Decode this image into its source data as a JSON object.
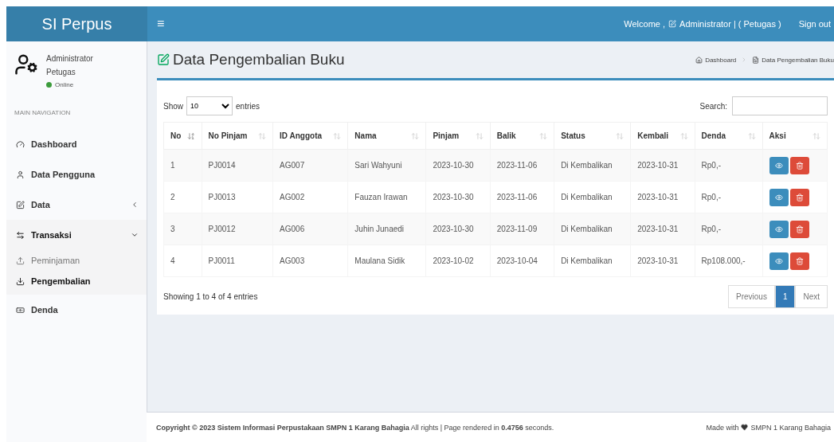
{
  "header": {
    "logo": "SI Perpus",
    "menu_toggle": "≡",
    "welcome": "Welcome ,",
    "user": "Administrator | ( Petugas )",
    "sign_out": "Sign out"
  },
  "user_panel": {
    "name": "Administrator",
    "role": "Petugas",
    "status": "Online"
  },
  "sidebar": {
    "heading": "MAIN NAVIGATION",
    "items": [
      {
        "label": "Dashboard",
        "selected": false
      },
      {
        "label": "Data Pengguna",
        "selected": false
      },
      {
        "label": "Data",
        "selected": false,
        "expanded": false
      },
      {
        "label": "Transaksi",
        "selected": true,
        "expanded": true,
        "children": [
          {
            "label": "Peminjaman",
            "selected": false
          },
          {
            "label": "Pengembalian",
            "selected": true
          }
        ]
      },
      {
        "label": "Denda",
        "selected": false
      }
    ]
  },
  "page": {
    "title": "Data Pengembalian Buku",
    "breadcrumb": [
      "Dashboard",
      "Data Pengembalian Buku"
    ]
  },
  "table_controls": {
    "show": "Show",
    "page_size": "10",
    "entries": "entries",
    "search_label": "Search:"
  },
  "table": {
    "columns": [
      {
        "label": "No",
        "sorted": true
      },
      {
        "label": "No Pinjam",
        "sorted": false
      },
      {
        "label": "ID Anggota",
        "sorted": false
      },
      {
        "label": "Nama",
        "sorted": false
      },
      {
        "label": "Pinjam",
        "sorted": false
      },
      {
        "label": "Balik",
        "sorted": false
      },
      {
        "label": "Status",
        "sorted": false
      },
      {
        "label": "Kembali",
        "sorted": false
      },
      {
        "label": "Denda",
        "sorted": false
      },
      {
        "label": "Aksi",
        "sorted": false
      }
    ],
    "rows": [
      [
        "1",
        "PJ0014",
        "AG007",
        "Sari Wahyuni",
        "2023-10-30",
        "2023-11-06",
        "Di Kembalikan",
        "2023-10-31",
        "Rp0,-"
      ],
      [
        "2",
        "PJ0013",
        "AG002",
        "Fauzan Irawan",
        "2023-10-30",
        "2023-11-06",
        "Di Kembalikan",
        "2023-10-31",
        "Rp0,-"
      ],
      [
        "3",
        "PJ0012",
        "AG006",
        "Juhin Junaedi",
        "2023-10-30",
        "2023-11-09",
        "Di Kembalikan",
        "2023-10-31",
        "Rp0,-"
      ],
      [
        "4",
        "PJ0011",
        "AG003",
        "Maulana Sidik",
        "2023-10-02",
        "2023-10-04",
        "Di Kembalikan",
        "2023-10-31",
        "Rp108.000,-"
      ]
    ]
  },
  "table_info": "Showing 1 to 4 of 4 entries",
  "pagination": [
    {
      "label": "Previous",
      "selected": false
    },
    {
      "label": "1",
      "selected": true
    },
    {
      "label": "Next",
      "selected": false
    }
  ],
  "footer": {
    "copyright": "**Copyright © 2023 Sistem Informasi Perpustakaan SMPN 1 Karang Bahagia** All rights | Page rendered in **0.4756** seconds.",
    "made_with": "Made with",
    "made_by": "SMPN 1 Karang Bahagia"
  }
}
